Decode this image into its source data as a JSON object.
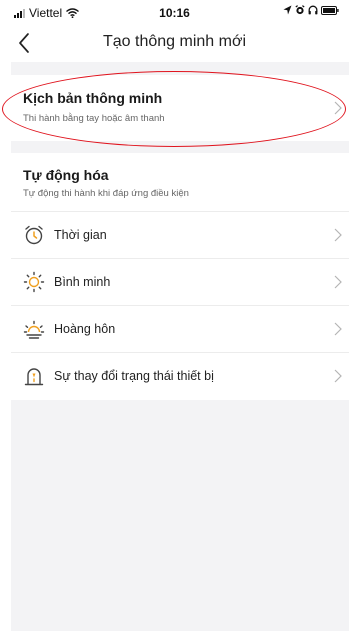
{
  "status_bar": {
    "carrier": "Viettel",
    "time": "10:16"
  },
  "header": {
    "title": "Tạo thông minh mới"
  },
  "smart_scene": {
    "title": "Kịch bản thông minh",
    "subtitle": "Thi hành bằng tay hoặc âm thanh"
  },
  "automation": {
    "title": "Tự động hóa",
    "subtitle": "Tự động thi hành khi đáp ứng điều kiện",
    "items": [
      {
        "label": "Thời gian",
        "icon": "alarm-clock-icon"
      },
      {
        "label": "Bình minh",
        "icon": "sunrise-icon"
      },
      {
        "label": "Hoàng hôn",
        "icon": "sunset-icon"
      },
      {
        "label": "Sự thay đổi trạng thái thiết bị",
        "icon": "device-state-icon"
      }
    ]
  },
  "colors": {
    "accent": "#f0a020",
    "highlight_ring": "#e0141e",
    "background": "#f3f3f5"
  }
}
